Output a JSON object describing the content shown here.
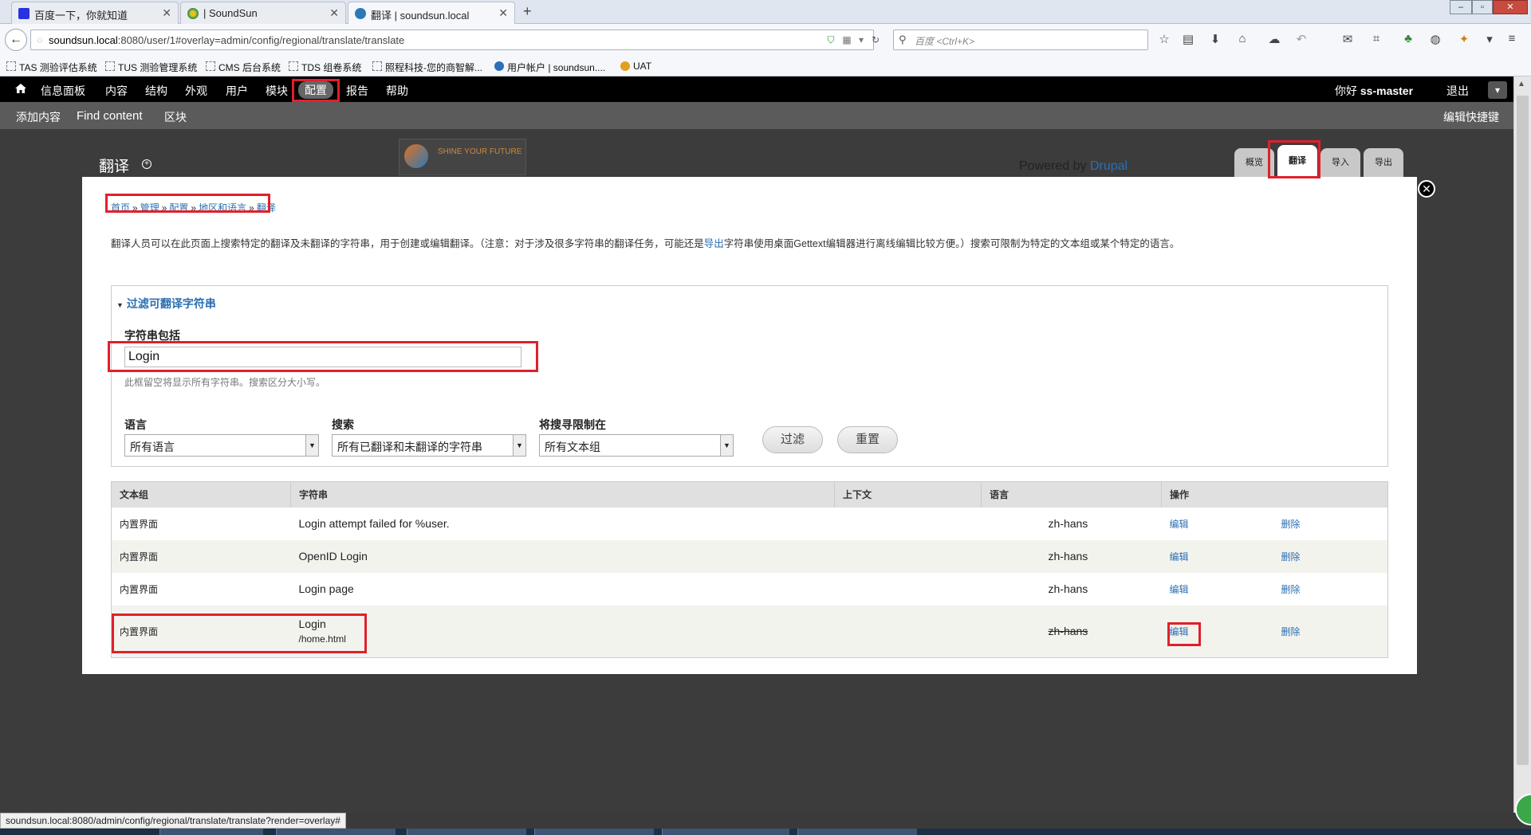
{
  "browser": {
    "tabs": [
      {
        "title": "百度一下，你就知道",
        "active": false
      },
      {
        "title": "| SoundSun",
        "active": false
      },
      {
        "title": "翻译 | soundsun.local",
        "active": true
      }
    ],
    "url_host": "soundsun.local",
    "url_rest": ":8080/user/1#overlay=admin/config/regional/translate/translate",
    "search_placeholder": "百度 <Ctrl+K>",
    "bookmarks": [
      "TAS 测验评估系统",
      "TUS 测验管理系统",
      "CMS 后台系统",
      "TDS 组卷系统",
      "照程科技-您的商智解...",
      "用户帐户 | soundsun....",
      "UAT"
    ],
    "status_url": "soundsun.local:8080/admin/config/regional/translate/translate?render=overlay#"
  },
  "toolbar": {
    "menu": [
      "信息面板",
      "内容",
      "结构",
      "外观",
      "用户",
      "模块",
      "配置",
      "报告",
      "帮助"
    ],
    "active_index": 6,
    "greeting_prefix": "你好 ",
    "username": "ss-master",
    "logout": "退出",
    "shortcuts": [
      "添加内容",
      "Find content",
      "区块"
    ],
    "edit_shortcuts": "编辑快捷键"
  },
  "overlay": {
    "title": "翻译",
    "logo_text": "SHINE YOUR FUTURE",
    "powered_prefix": "Powered by ",
    "powered_link": "Drupal",
    "tabs": [
      "概览",
      "翻译",
      "导入",
      "导出"
    ],
    "active_tab": 1
  },
  "breadcrumb": [
    "首页",
    "管理",
    "配置",
    "地区和语言",
    "翻译"
  ],
  "description": {
    "before": "翻译人员可以在此页面上搜索特定的翻译及未翻译的字符串，用于创建或编辑翻译。（注意：对于涉及很多字符串的翻译任务，可能还是",
    "link": "导出",
    "after": "字符串使用桌面Gettext编辑器进行离线编辑比较方便。）搜索可限制为特定的文本组或某个特定的语言。"
  },
  "filter": {
    "legend": "过滤可翻译字符串",
    "contains_label": "字符串包括",
    "contains_value": "Login",
    "hint": "此框留空将显示所有字符串。搜索区分大小写。",
    "language_label": "语言",
    "language_value": "所有语言",
    "search_label": "搜索",
    "search_value": "所有已翻译和未翻译的字符串",
    "limit_label": "将搜寻限制在",
    "limit_value": "所有文本组",
    "filter_button": "过滤",
    "reset_button": "重置"
  },
  "table": {
    "headers": [
      "文本组",
      "字符串",
      "上下文",
      "语言",
      "操作"
    ],
    "rows": [
      {
        "group": "内置界面",
        "string": "Login attempt failed for %user.",
        "context": "",
        "lang": "zh-hans",
        "edit": "编辑",
        "delete": "删除"
      },
      {
        "group": "内置界面",
        "string": "OpenID Login",
        "context": "",
        "lang": "zh-hans",
        "edit": "编辑",
        "delete": "删除"
      },
      {
        "group": "内置界面",
        "string": "Login page",
        "context": "",
        "lang": "zh-hans",
        "edit": "编辑",
        "delete": "删除"
      },
      {
        "group": "内置界面",
        "string": "Login",
        "string_sub": "/home.html",
        "context": "",
        "lang": "zh-hans",
        "edit": "编辑",
        "delete": "删除"
      }
    ]
  }
}
